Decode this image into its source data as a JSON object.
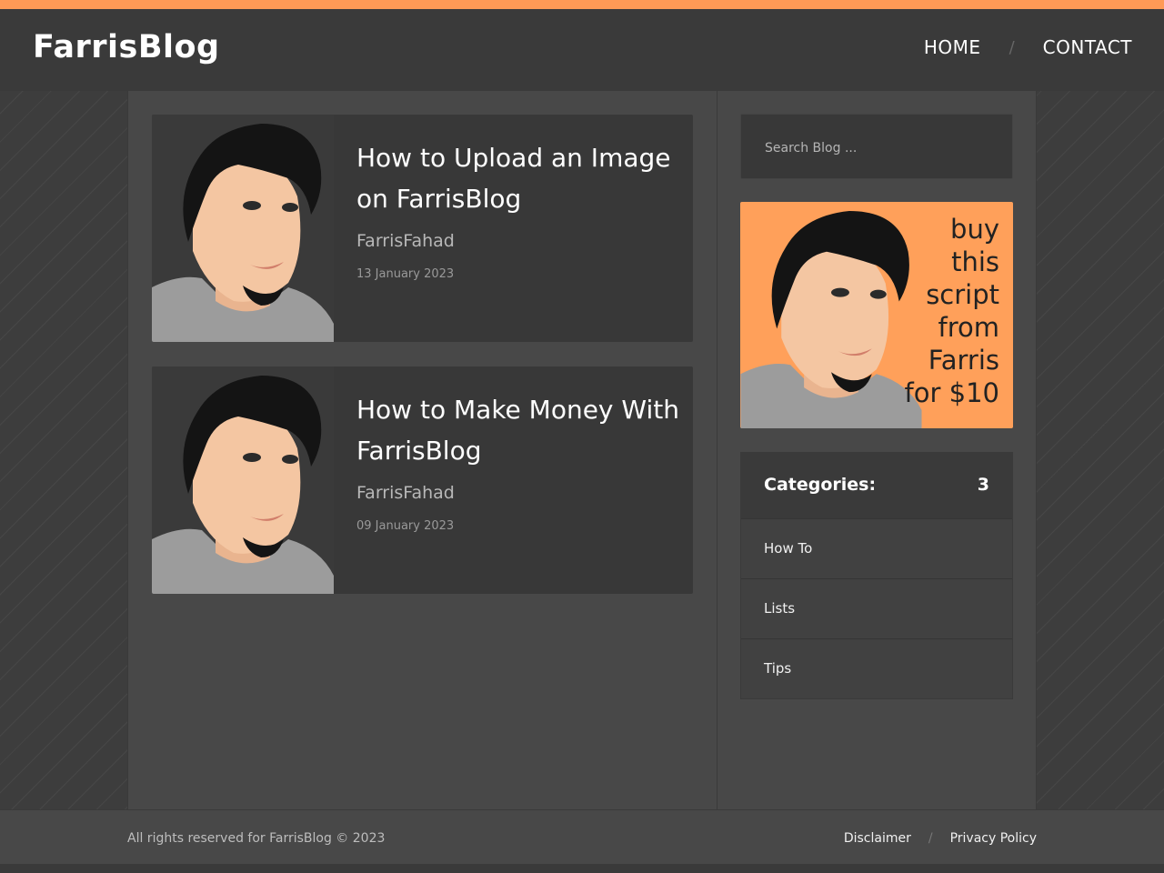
{
  "header": {
    "logo": "FarrisBlog",
    "nav": [
      {
        "label": "HOME"
      },
      {
        "label": "CONTACT"
      }
    ],
    "separator": "/"
  },
  "posts": [
    {
      "title": "How to Upload an Image on FarrisBlog",
      "author": "FarrisFahad",
      "date": "13 January 2023"
    },
    {
      "title": "How to Make Money With FarrisBlog",
      "author": "FarrisFahad",
      "date": "09 January 2023"
    }
  ],
  "sidebar": {
    "search_placeholder": "Search Blog ...",
    "ad_lines": [
      "buy",
      "this",
      "script",
      "from",
      "Farris",
      "for $10"
    ],
    "categories_label": "Categories:",
    "categories_count": "3",
    "categories": [
      {
        "label": "How To"
      },
      {
        "label": "Lists"
      },
      {
        "label": "Tips"
      }
    ]
  },
  "footer": {
    "copyright": "All rights reserved for FarrisBlog © 2023",
    "links": [
      {
        "label": "Disclaimer"
      },
      {
        "label": "Privacy Policy"
      }
    ],
    "separator": "/"
  },
  "colors": {
    "accent": "#ff9a56",
    "ad_background": "#ffa05a"
  },
  "icons": [
    "avatar-illustration"
  ]
}
